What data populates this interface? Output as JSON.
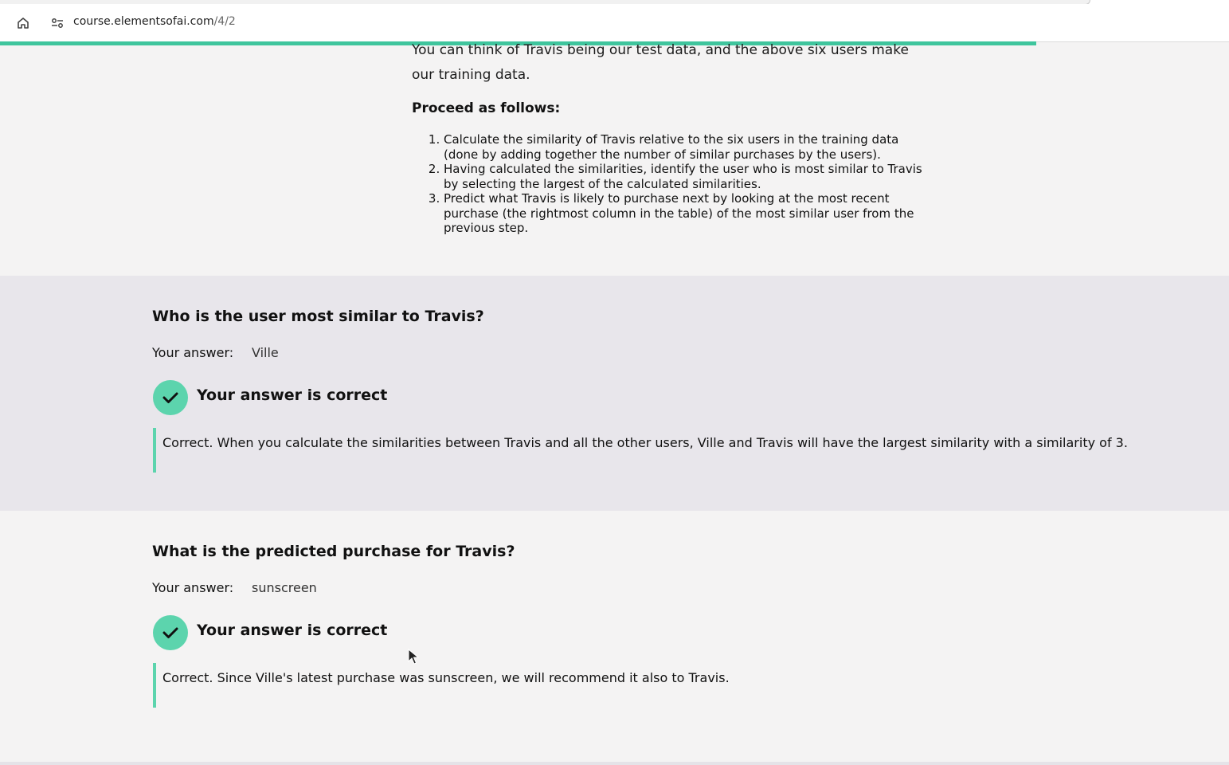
{
  "browser": {
    "url_host": "course.elementsofai.com",
    "url_path": "/4/2"
  },
  "page": {
    "progress": 0.843,
    "accent_color": "#3fc59d",
    "correct_color": "#5cd4ad",
    "intro_text": "You can think of Travis being our test data, and the above six users make our training data.",
    "proceed_heading": "Proceed as follows:",
    "steps": [
      "Calculate the similarity of Travis relative to the six users in the training data (done by adding together the number of similar purchases by the users).",
      "Having calculated the similarities, identify the user who is most similar to Travis by selecting the largest of the calculated similarities.",
      "Predict what Travis is likely to purchase next by looking at the most recent purchase (the rightmost column in the table) of the most similar user from the previous step."
    ]
  },
  "q1": {
    "title": "Who is the user most similar to Travis?",
    "answer_label": "Your answer:",
    "answer_value": "Ville",
    "result": "Your answer is correct",
    "explanation": "Correct. When you calculate the similarities between Travis and all the other users, Ville and Travis will have the largest similarity with a similarity of 3."
  },
  "q2": {
    "title": "What is the predicted purchase for Travis?",
    "answer_label": "Your answer:",
    "answer_value": "sunscreen",
    "result": "Your answer is correct",
    "explanation": "Correct. Since Ville's latest purchase was sunscreen, we will recommend it also to Travis."
  }
}
